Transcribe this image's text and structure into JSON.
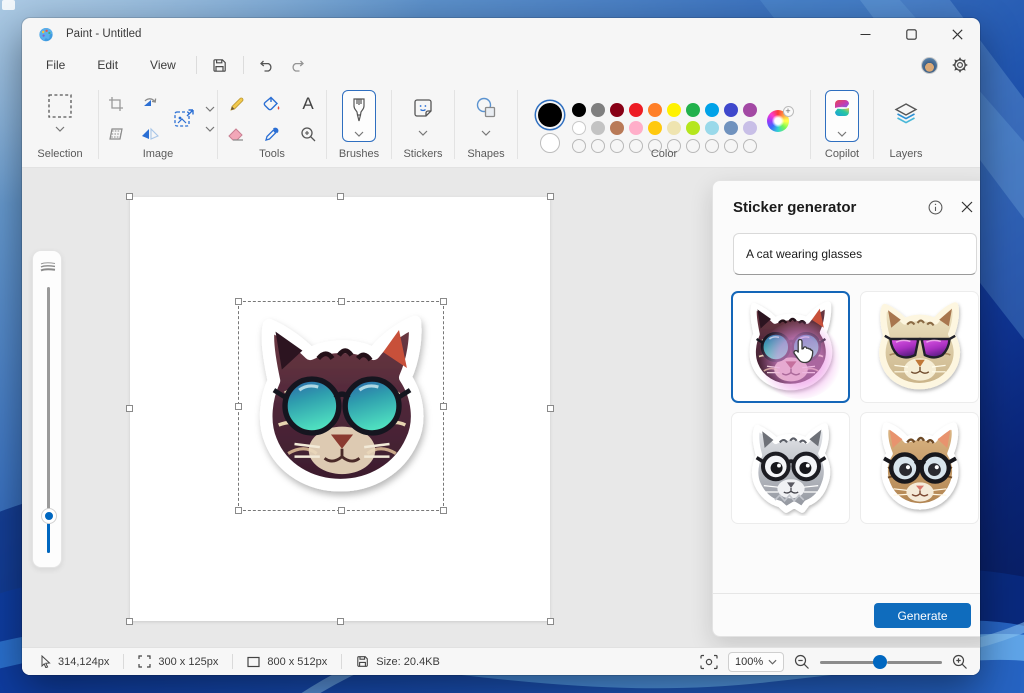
{
  "window": {
    "title": "Paint - Untitled",
    "menu_items": [
      "File",
      "Edit",
      "View"
    ]
  },
  "toolbar": {
    "groups": {
      "selection": "Selection",
      "image": "Image",
      "tools": "Tools",
      "brushes": "Brushes",
      "stickers": "Stickers",
      "shapes": "Shapes",
      "color": "Color",
      "copilot": "Copilot",
      "layers": "Layers"
    },
    "text_tool_glyph": "A",
    "color_palette": {
      "primary": "#000000",
      "secondary": "#ffffff",
      "row1": [
        "#000000",
        "#7f7f7f",
        "#880015",
        "#ed1c24",
        "#ff7f27",
        "#fff200",
        "#22b14c",
        "#00a2e8",
        "#3f48cc",
        "#a349a4"
      ],
      "row2": [
        "#ffffff",
        "#c3c3c3",
        "#b97a57",
        "#ffaec9",
        "#ffc90e",
        "#efe4b0",
        "#b5e61d",
        "#99d9ea",
        "#7092be",
        "#c8bfe7"
      ],
      "empty_slots": 10
    }
  },
  "sticker_panel": {
    "title": "Sticker generator",
    "prompt_value": "A cat wearing glasses",
    "generate_label": "Generate",
    "thumbnails": [
      {
        "name": "dark cat with round teal sunglasses",
        "selected": true
      },
      {
        "name": "tan cat with magenta aviator sunglasses",
        "selected": false
      },
      {
        "name": "gray cat with round black glasses",
        "selected": false
      },
      {
        "name": "tabby kitten with large round glasses",
        "selected": false
      }
    ]
  },
  "status_bar": {
    "cursor_position": "314,124px",
    "selection_size": "300  x  125px",
    "canvas_size": "800  x  512px",
    "file_size": "Size: 20.4KB",
    "zoom_value": "100%"
  },
  "colors": {
    "accent_blue": "#0f6cbd",
    "selected_thumb_border": "#1466b8",
    "slider_blue": "#0067c0"
  }
}
